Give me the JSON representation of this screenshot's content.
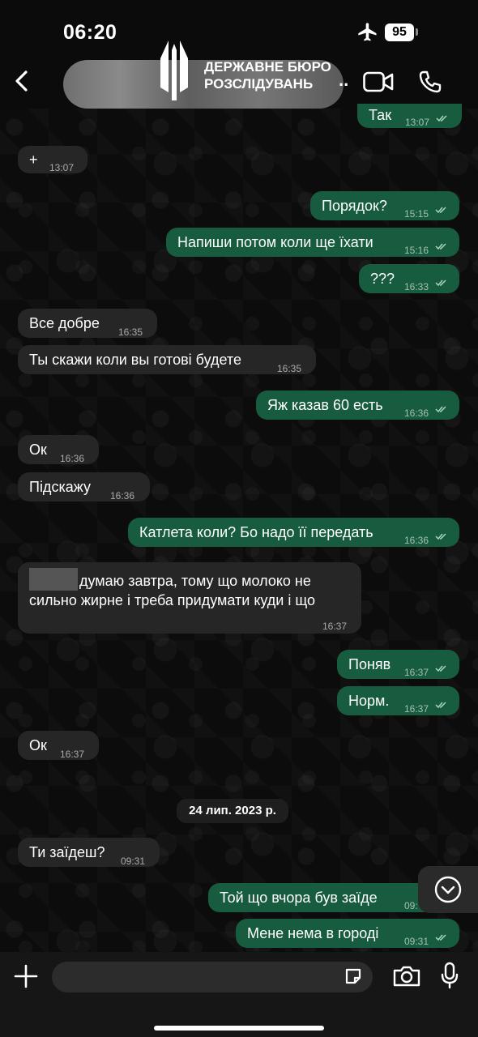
{
  "status_bar": {
    "time": "06:20",
    "battery": "95"
  },
  "header": {
    "contact_name_line1": "ДЕРЖАВНЕ БЮРО",
    "contact_name_line2": "РОЗСЛІДУВАНЬ",
    "overflow": ".."
  },
  "messages": [
    {
      "dir": "out",
      "text": "Так",
      "time": "13:07"
    },
    {
      "dir": "in",
      "text": "+",
      "time": "13:07"
    },
    {
      "dir": "out",
      "text": "Порядок?",
      "time": "15:15"
    },
    {
      "dir": "out",
      "text": "Напиши потом коли ще їхати",
      "time": "15:16"
    },
    {
      "dir": "out",
      "text": "???",
      "time": "16:33"
    },
    {
      "dir": "in",
      "text": "Все добре",
      "time": "16:35"
    },
    {
      "dir": "in",
      "text": "Ты скажи коли вы готові будете",
      "time": "16:35"
    },
    {
      "dir": "out",
      "text": "Яж казав 60 есть",
      "time": "16:36"
    },
    {
      "dir": "in",
      "text": "Ок",
      "time": "16:36"
    },
    {
      "dir": "in",
      "text": "Підскажу",
      "time": "16:36"
    },
    {
      "dir": "out",
      "text": "Катлета коли? Бо надо її передать",
      "time": "16:36"
    },
    {
      "dir": "in",
      "text": "думаю завтра, тому що молоко не",
      "text2": "сильно жирне і треба придумати куди і що",
      "time": "16:37"
    },
    {
      "dir": "out",
      "text": "Поняв",
      "time": "16:37"
    },
    {
      "dir": "out",
      "text": "Норм.",
      "time": "16:37"
    },
    {
      "dir": "in",
      "text": "Ок",
      "time": "16:37"
    },
    {
      "dir": "in",
      "text": "Ти заїдеш?",
      "time": "09:31"
    },
    {
      "dir": "out",
      "text": "Той що вчора був заїде",
      "time": "09:"
    },
    {
      "dir": "out",
      "text": "Мене нема в городі",
      "time": "09:31"
    }
  ],
  "date_separator": "24 лип. 2023 р.",
  "input": {
    "placeholder": ""
  },
  "colors": {
    "outgoing": "#175c3e",
    "incoming": "#262626",
    "background": "#0b0b0b",
    "read_check": "#a8d5bf"
  }
}
